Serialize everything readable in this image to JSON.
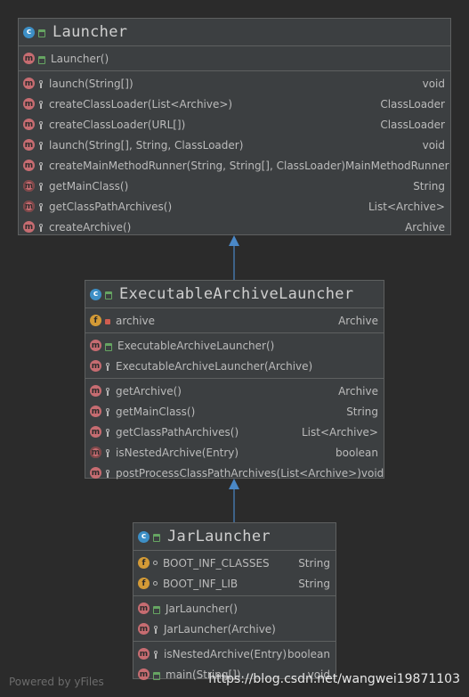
{
  "classes": {
    "launcher": {
      "name": "Launcher",
      "constructors": [
        {
          "name": "Launcher()",
          "type": "",
          "kind": "method",
          "visibility": "public"
        }
      ],
      "methods": [
        {
          "name": "launch(String[])",
          "type": "void",
          "kind": "method",
          "visibility": "protected"
        },
        {
          "name": "createClassLoader(List<Archive>)",
          "type": "ClassLoader",
          "kind": "method",
          "visibility": "protected"
        },
        {
          "name": "createClassLoader(URL[])",
          "type": "ClassLoader",
          "kind": "method",
          "visibility": "protected"
        },
        {
          "name": "launch(String[], String, ClassLoader)",
          "type": "void",
          "kind": "method",
          "visibility": "protected"
        },
        {
          "name": "createMainMethodRunner(String, String[], ClassLoader)",
          "type": "MainMethodRunner",
          "kind": "method",
          "visibility": "protected"
        },
        {
          "name": "getMainClass()",
          "type": "String",
          "kind": "abstract",
          "visibility": "protected"
        },
        {
          "name": "getClassPathArchives()",
          "type": "List<Archive>",
          "kind": "abstract",
          "visibility": "protected"
        },
        {
          "name": "createArchive()",
          "type": "Archive",
          "kind": "method",
          "visibility": "protected"
        }
      ]
    },
    "executable": {
      "name": "ExecutableArchiveLauncher",
      "fields": [
        {
          "name": "archive",
          "type": "Archive",
          "kind": "field",
          "visibility": "private"
        }
      ],
      "constructors": [
        {
          "name": "ExecutableArchiveLauncher()",
          "type": "",
          "kind": "method",
          "visibility": "public"
        },
        {
          "name": "ExecutableArchiveLauncher(Archive)",
          "type": "",
          "kind": "method",
          "visibility": "protected"
        }
      ],
      "methods": [
        {
          "name": "getArchive()",
          "type": "Archive",
          "kind": "method",
          "visibility": "protected"
        },
        {
          "name": "getMainClass()",
          "type": "String",
          "kind": "method",
          "visibility": "protected"
        },
        {
          "name": "getClassPathArchives()",
          "type": "List<Archive>",
          "kind": "method",
          "visibility": "protected"
        },
        {
          "name": "isNestedArchive(Entry)",
          "type": "boolean",
          "kind": "abstract",
          "visibility": "protected"
        },
        {
          "name": "postProcessClassPathArchives(List<Archive>)",
          "type": "void",
          "kind": "method",
          "visibility": "protected"
        }
      ]
    },
    "jar": {
      "name": "JarLauncher",
      "fields": [
        {
          "name": "BOOT_INF_CLASSES",
          "type": "String",
          "kind": "field",
          "visibility": "package"
        },
        {
          "name": "BOOT_INF_LIB",
          "type": "String",
          "kind": "field",
          "visibility": "package"
        }
      ],
      "constructors": [
        {
          "name": "JarLauncher()",
          "type": "",
          "kind": "method",
          "visibility": "public"
        },
        {
          "name": "JarLauncher(Archive)",
          "type": "",
          "kind": "method",
          "visibility": "protected"
        }
      ],
      "methods": [
        {
          "name": "isNestedArchive(Entry)",
          "type": "boolean",
          "kind": "method",
          "visibility": "protected"
        },
        {
          "name": "main(String[])",
          "type": "void",
          "kind": "method",
          "visibility": "public"
        }
      ]
    }
  },
  "footer": {
    "powered_by": "Powered by yFiles",
    "watermark": "https://blog.csdn.net/wangwei19871103"
  },
  "colors": {
    "background": "#2b2b2b",
    "box": "#3c3f41",
    "arrow": "#4a88c7",
    "method_icon": "#c66c71",
    "field_icon": "#d39a36",
    "class_icon": "#3d8fc6"
  }
}
